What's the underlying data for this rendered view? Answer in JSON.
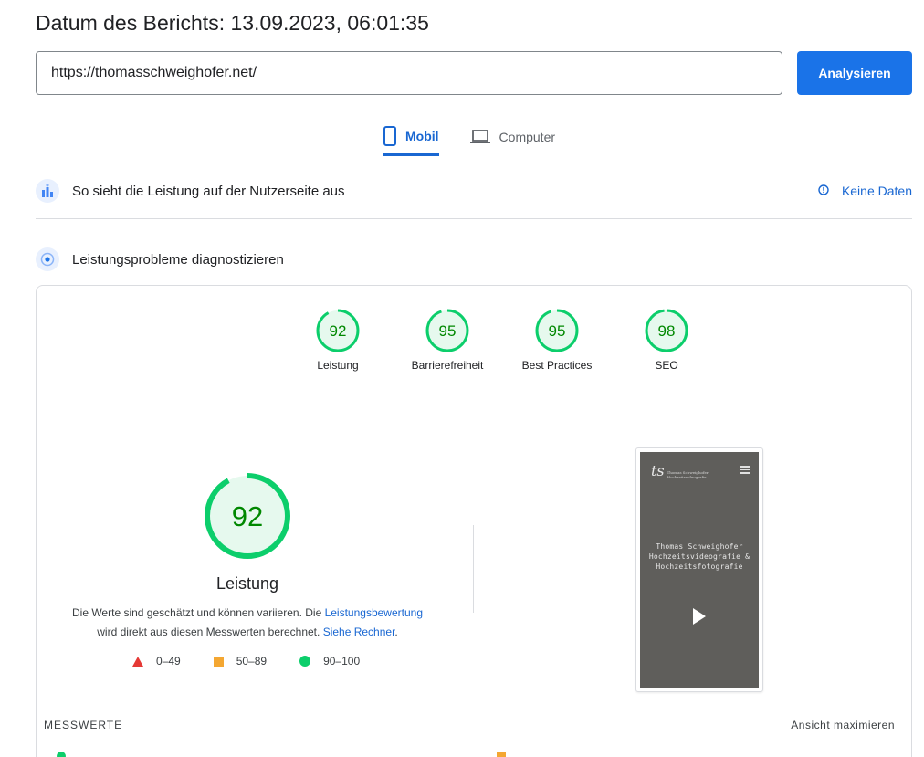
{
  "header": {
    "title": "Datum des Berichts: 13.09.2023, 06:01:35"
  },
  "search": {
    "value": "https://thomasschweighofer.net/",
    "button_label": "Analysieren"
  },
  "tabs": [
    {
      "label": "Mobil",
      "icon": "smartphone-icon",
      "active": true
    },
    {
      "label": "Computer",
      "icon": "laptop-icon",
      "active": false
    }
  ],
  "crux": {
    "label": "So sieht die Leistung auf der Nutzerseite aus",
    "no_data_label": "Keine Daten",
    "icon": "field-data-icon"
  },
  "diagnose": {
    "label": "Leistungsprobleme diagnostizieren",
    "icon": "lab-data-icon"
  },
  "colors": {
    "accent": "#1a73e8",
    "pass_green": "#0cce6b",
    "pass_text": "#008800",
    "average": "#f4a732",
    "fail": "#e53935"
  },
  "scores": [
    {
      "value": "92",
      "label": "Leistung"
    },
    {
      "value": "95",
      "label": "Barrierefreiheit"
    },
    {
      "value": "95",
      "label": "Best Practices"
    },
    {
      "value": "98",
      "label": "SEO"
    }
  ],
  "performance": {
    "score": "92",
    "label": "Leistung",
    "desc_part1": "Die Werte sind geschätzt und können variieren. Die ",
    "desc_link1": "Leistungsbewertung",
    "desc_part2": "wird direkt aus diesen Messwerten berechnet. ",
    "desc_link2": "Siehe Rechner",
    "desc_part3": "."
  },
  "legend": [
    {
      "shape": "triangle",
      "range": "0–49"
    },
    {
      "shape": "square",
      "range": "50–89"
    },
    {
      "shape": "circle",
      "range": "90–100"
    }
  ],
  "screenshot": {
    "brand_line1": "Thomas Schweighofer",
    "brand_line2": "Hochzeitsvideografie",
    "headline": "Thomas Schweighofer Hochzeitsvideografie & Hochzeitsfotografie"
  },
  "metrics": {
    "heading": "MESSWERTE",
    "expand_label": "Ansicht maximieren"
  }
}
